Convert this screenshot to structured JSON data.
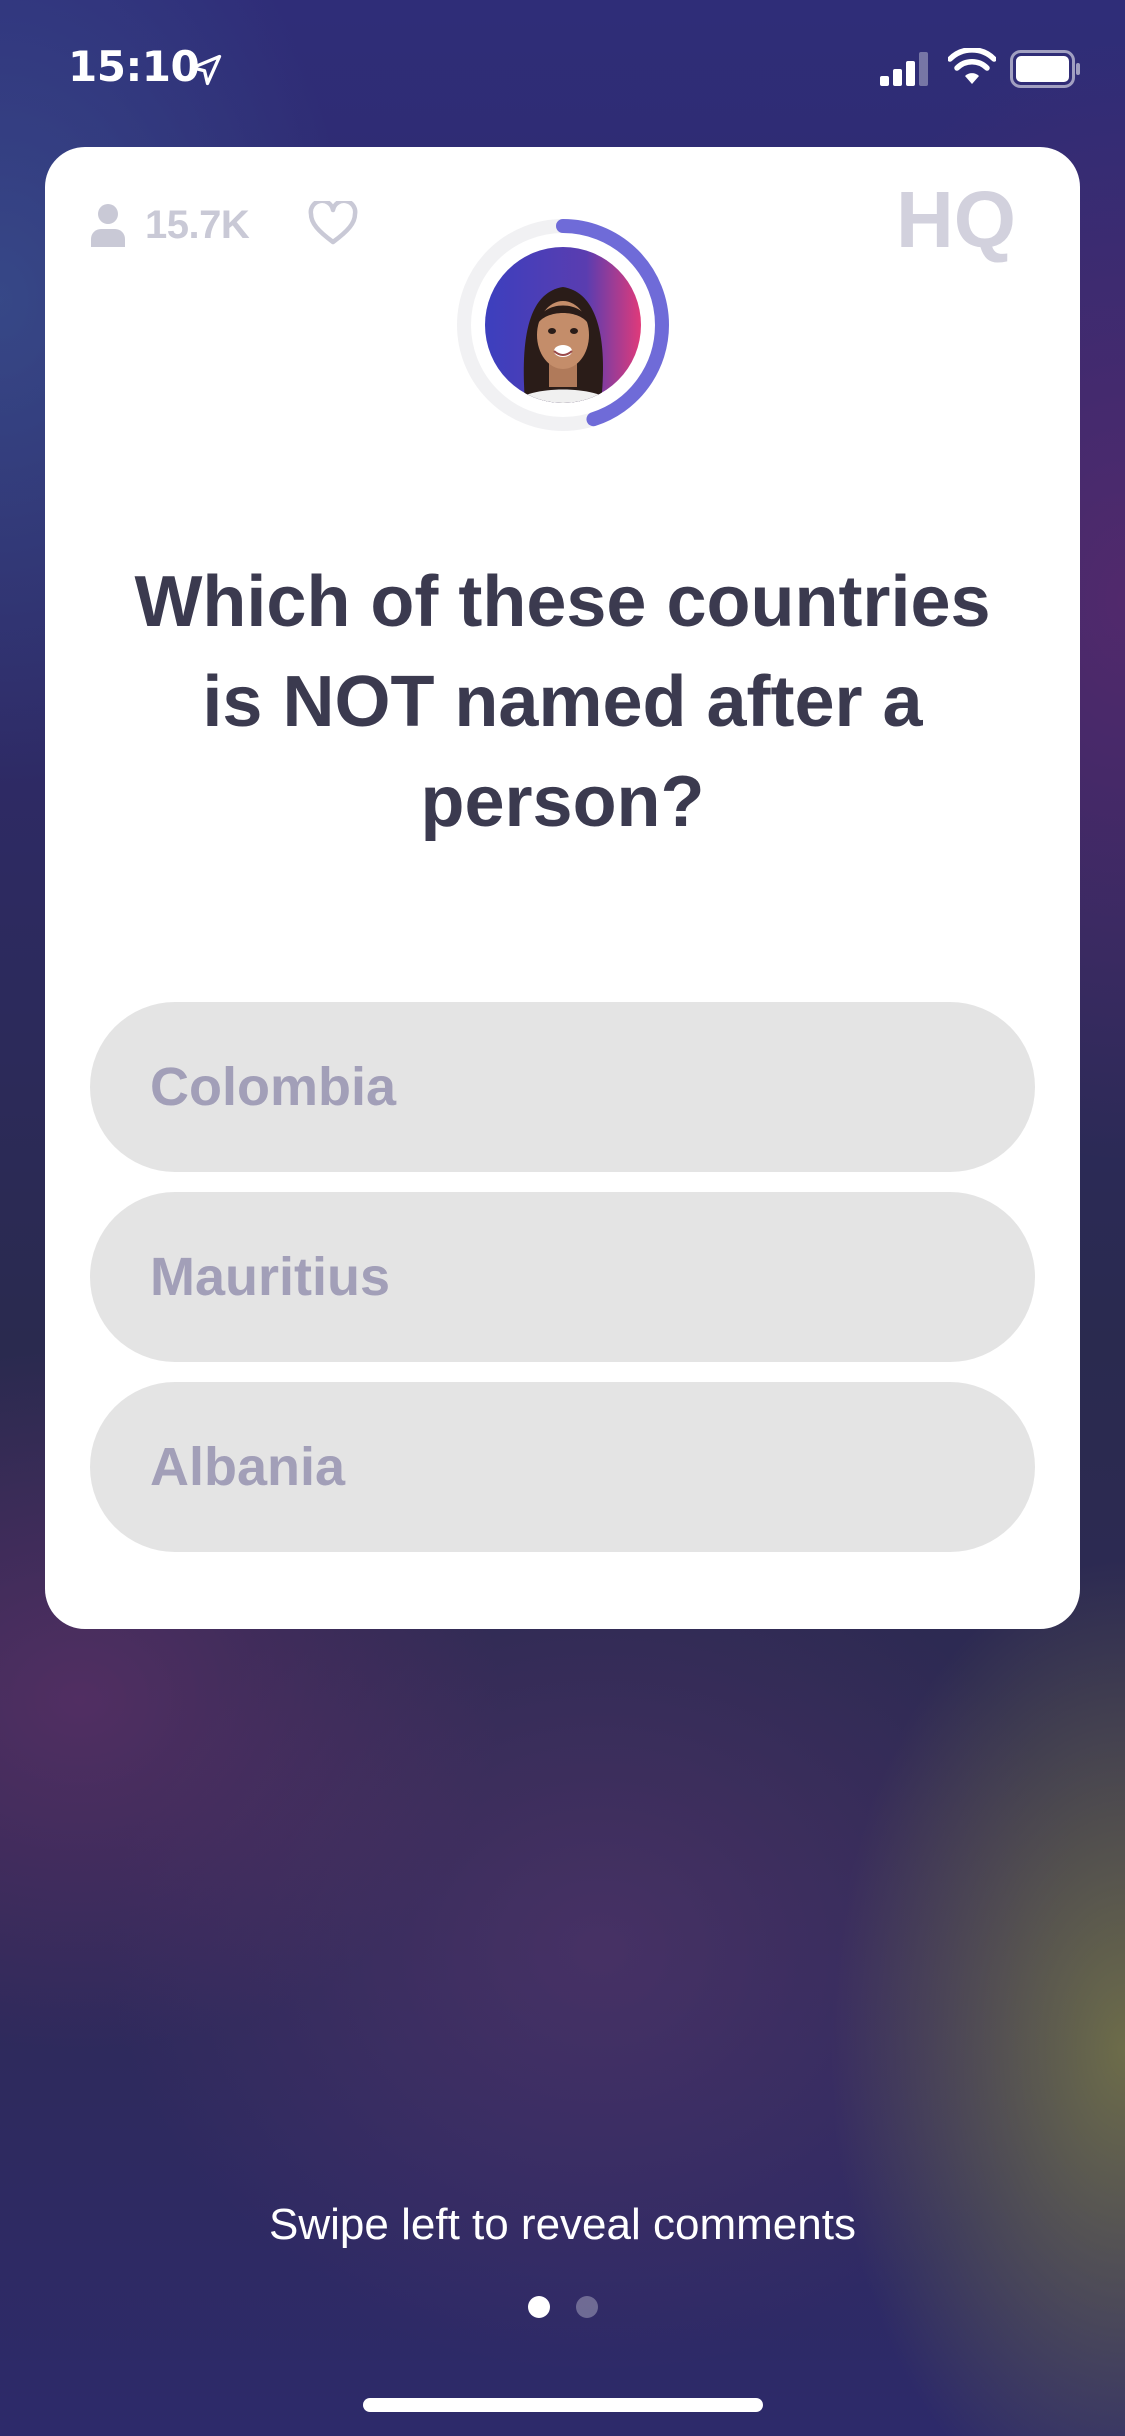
{
  "status_bar": {
    "time": "15:10",
    "icons": [
      "location-arrow-icon",
      "signal-icon",
      "wifi-icon",
      "battery-icon"
    ]
  },
  "card": {
    "viewer_count": "15.7K",
    "logo_text": "HQ",
    "icons": [
      "person-icon",
      "heart-icon",
      "hq-logo"
    ],
    "timer_progress": 0.45,
    "accent_color": "#6f6bd8",
    "question": "Which of these countries is NOT named after a person?",
    "answers": [
      {
        "label": "Colombia"
      },
      {
        "label": "Mauritius"
      },
      {
        "label": "Albania"
      }
    ]
  },
  "footer": {
    "swipe_hint": "Swipe left to reveal comments",
    "page_dots": {
      "total": 2,
      "active": 1
    }
  }
}
